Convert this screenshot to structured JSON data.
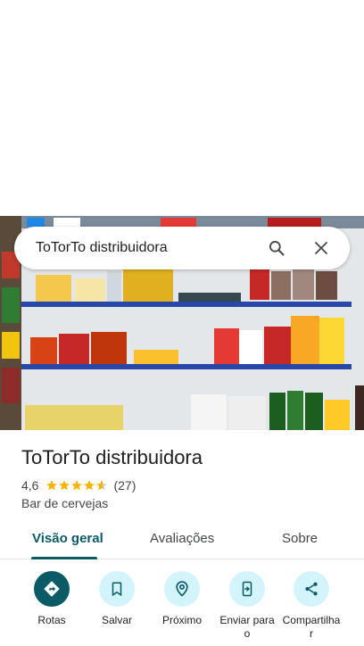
{
  "search": {
    "query": "ToTorTo distribuidora"
  },
  "place": {
    "name": "ToTorTo distribuidora",
    "rating": "4,6",
    "rating_value": 4.6,
    "review_count": "(27)",
    "category": "Bar de cervejas"
  },
  "tabs": [
    {
      "label": "Visão geral",
      "active": true
    },
    {
      "label": "Avaliações",
      "active": false
    },
    {
      "label": "Sobre",
      "active": false
    }
  ],
  "actions": [
    {
      "label": "Rotas",
      "icon": "directions-icon"
    },
    {
      "label": "Salvar",
      "icon": "bookmark-icon"
    },
    {
      "label": "Próximo",
      "icon": "nearby-icon"
    },
    {
      "label": "Enviar para o",
      "icon": "send-to-phone-icon"
    },
    {
      "label": "Compartilhar",
      "icon": "share-icon"
    }
  ],
  "colors": {
    "accent": "#0b5b66",
    "action_bg": "#d3f4fb",
    "star": "#f5b400"
  }
}
